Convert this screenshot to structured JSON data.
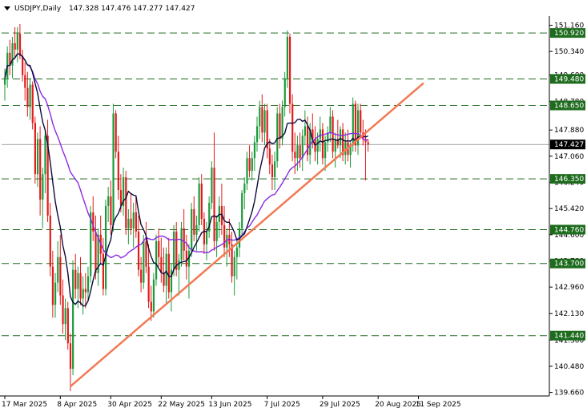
{
  "header": {
    "symbol": "USDJPY,Daily",
    "ohlc": "147.328 147.476 147.277 147.427"
  },
  "colors": {
    "background": "#ffffff",
    "axis": "#000000",
    "bull": "#1c9a3a",
    "bear": "#e31b1b",
    "ma_fast": "#0b0b3b",
    "ma_slow": "#8a2be2",
    "trendline": "#f27a55",
    "level_line": "#1e6b1e",
    "price_line": "#888888"
  },
  "chart_data": {
    "type": "candlestick",
    "title": "USDJPY,Daily",
    "y_ticks": [
      "151.160",
      "150.340",
      "149.600",
      "148.780",
      "147.880",
      "147.060",
      "146.240",
      "145.420",
      "144.600",
      "143.780",
      "142.960",
      "142.130",
      "141.300",
      "140.480",
      "139.660"
    ],
    "x_ticks": [
      "17 Mar 2025",
      "8 Apr 2025",
      "30 Apr 2025",
      "22 May 2025",
      "13 Jun 2025",
      "7 Jul 2025",
      "29 Jul 2025",
      "20 Aug 2025",
      "11 Sep 2025"
    ],
    "ylim": [
      139.55,
      151.45
    ],
    "levels": [
      {
        "value": 150.92,
        "label": "150.920"
      },
      {
        "value": 149.48,
        "label": "149.480"
      },
      {
        "value": 148.65,
        "label": "148.650"
      },
      {
        "value": 146.35,
        "label": "146.350"
      },
      {
        "value": 144.76,
        "label": "144.760"
      },
      {
        "value": 143.7,
        "label": "143.700"
      },
      {
        "value": 141.44,
        "label": "141.440"
      }
    ],
    "current_price": {
      "value": 147.427,
      "label": "147.427"
    },
    "trendline": {
      "from": {
        "bar": 26,
        "price": 139.85
      },
      "to": {
        "bar": 166,
        "price": 149.35
      }
    },
    "candles": [
      [
        149.3,
        149.8,
        148.8,
        149.5
      ],
      [
        149.5,
        150.5,
        149.2,
        150.3
      ],
      [
        150.3,
        150.7,
        149.6,
        149.9
      ],
      [
        149.9,
        150.8,
        149.5,
        150.6
      ],
      [
        150.6,
        151.1,
        150.1,
        150.4
      ],
      [
        150.4,
        151.1,
        150.0,
        150.9
      ],
      [
        150.9,
        151.2,
        150.1,
        150.2
      ],
      [
        150.2,
        150.4,
        149.4,
        149.6
      ],
      [
        149.6,
        150.0,
        148.8,
        149.2
      ],
      [
        149.2,
        149.7,
        148.3,
        148.6
      ],
      [
        148.6,
        149.5,
        148.2,
        149.3
      ],
      [
        149.3,
        149.4,
        147.9,
        148.1
      ],
      [
        148.1,
        148.3,
        146.2,
        146.5
      ],
      [
        146.5,
        147.8,
        146.1,
        147.6
      ],
      [
        147.6,
        148.0,
        145.2,
        145.7
      ],
      [
        145.7,
        146.7,
        144.8,
        146.5
      ],
      [
        146.5,
        147.9,
        145.9,
        147.7
      ],
      [
        147.7,
        148.2,
        145.0,
        145.2
      ],
      [
        145.2,
        145.6,
        143.3,
        143.6
      ],
      [
        143.6,
        144.1,
        142.0,
        142.4
      ],
      [
        142.4,
        143.4,
        142.0,
        143.1
      ],
      [
        143.1,
        144.4,
        142.8,
        143.9
      ],
      [
        143.9,
        144.6,
        142.4,
        142.7
      ],
      [
        142.7,
        143.2,
        141.5,
        141.8
      ],
      [
        141.8,
        142.6,
        141.3,
        142.3
      ],
      [
        142.3,
        142.5,
        141.0,
        141.2
      ],
      [
        141.2,
        141.5,
        139.7,
        140.4
      ],
      [
        140.4,
        143.8,
        140.2,
        143.5
      ],
      [
        143.5,
        144.0,
        142.6,
        142.9
      ],
      [
        142.9,
        143.6,
        142.3,
        143.4
      ],
      [
        143.4,
        143.9,
        142.4,
        142.6
      ],
      [
        142.6,
        143.3,
        142.1,
        142.9
      ],
      [
        142.9,
        143.4,
        142.3,
        142.8
      ],
      [
        142.8,
        143.6,
        142.5,
        143.3
      ],
      [
        143.3,
        145.5,
        143.1,
        145.3
      ],
      [
        145.3,
        145.8,
        144.4,
        144.7
      ],
      [
        144.7,
        145.2,
        143.2,
        143.4
      ],
      [
        143.4,
        144.8,
        143.0,
        144.6
      ],
      [
        144.6,
        145.2,
        143.7,
        144.0
      ],
      [
        144.0,
        144.5,
        142.7,
        142.9
      ],
      [
        142.9,
        145.7,
        142.7,
        145.5
      ],
      [
        145.5,
        146.1,
        145.0,
        145.8
      ],
      [
        145.8,
        146.3,
        144.6,
        144.9
      ],
      [
        144.9,
        148.7,
        144.7,
        148.4
      ],
      [
        148.4,
        148.5,
        147.0,
        147.2
      ],
      [
        147.2,
        147.7,
        145.7,
        146.0
      ],
      [
        146.0,
        146.5,
        145.3,
        145.5
      ],
      [
        145.5,
        146.7,
        145.2,
        146.4
      ],
      [
        146.4,
        146.6,
        144.6,
        144.8
      ],
      [
        144.8,
        145.4,
        144.3,
        145.1
      ],
      [
        145.1,
        145.9,
        144.6,
        144.8
      ],
      [
        144.8,
        145.6,
        144.2,
        145.3
      ],
      [
        145.3,
        145.8,
        144.5,
        144.7
      ],
      [
        144.7,
        145.2,
        143.3,
        143.5
      ],
      [
        143.5,
        143.9,
        142.8,
        143.1
      ],
      [
        143.1,
        144.6,
        142.9,
        144.4
      ],
      [
        144.4,
        145.0,
        143.4,
        143.6
      ],
      [
        143.6,
        144.3,
        142.3,
        142.5
      ],
      [
        142.5,
        143.0,
        141.9,
        142.2
      ],
      [
        142.2,
        143.4,
        142.0,
        143.2
      ],
      [
        143.2,
        144.6,
        143.0,
        144.4
      ],
      [
        144.4,
        144.8,
        143.6,
        143.9
      ],
      [
        143.9,
        144.5,
        143.1,
        143.4
      ],
      [
        143.4,
        144.2,
        142.8,
        143.0
      ],
      [
        143.0,
        144.2,
        142.4,
        144.0
      ],
      [
        144.0,
        144.5,
        142.6,
        142.8
      ],
      [
        142.8,
        143.7,
        142.2,
        143.5
      ],
      [
        143.5,
        144.9,
        143.3,
        144.7
      ],
      [
        144.7,
        145.0,
        143.3,
        143.5
      ],
      [
        143.5,
        144.0,
        142.7,
        143.8
      ],
      [
        143.8,
        145.0,
        143.6,
        144.8
      ],
      [
        144.8,
        145.4,
        143.8,
        144.1
      ],
      [
        144.1,
        144.6,
        143.2,
        143.6
      ],
      [
        143.6,
        144.3,
        142.6,
        144.1
      ],
      [
        144.1,
        145.6,
        143.9,
        145.4
      ],
      [
        145.4,
        145.8,
        144.4,
        144.6
      ],
      [
        144.6,
        145.2,
        144.1,
        144.9
      ],
      [
        144.9,
        146.4,
        144.7,
        146.2
      ],
      [
        146.2,
        146.5,
        144.9,
        145.1
      ],
      [
        145.1,
        145.3,
        144.0,
        144.3
      ],
      [
        144.3,
        145.0,
        143.8,
        144.7
      ],
      [
        144.7,
        145.8,
        144.5,
        145.6
      ],
      [
        145.6,
        146.9,
        145.4,
        146.7
      ],
      [
        146.7,
        147.8,
        144.1,
        144.4
      ],
      [
        144.4,
        145.2,
        143.9,
        145.0
      ],
      [
        145.0,
        145.8,
        144.5,
        145.5
      ],
      [
        145.5,
        146.2,
        144.6,
        144.9
      ],
      [
        144.9,
        145.5,
        143.9,
        144.2
      ],
      [
        144.2,
        144.8,
        143.6,
        144.6
      ],
      [
        144.6,
        145.1,
        143.9,
        144.3
      ],
      [
        144.3,
        144.7,
        143.1,
        143.3
      ],
      [
        143.3,
        144.1,
        142.7,
        143.9
      ],
      [
        143.9,
        144.4,
        143.2,
        144.2
      ],
      [
        144.2,
        145.0,
        143.9,
        144.8
      ],
      [
        144.8,
        146.0,
        144.6,
        145.9
      ],
      [
        145.9,
        146.4,
        145.4,
        146.2
      ],
      [
        146.2,
        147.2,
        146.0,
        147.0
      ],
      [
        147.0,
        147.4,
        146.4,
        146.6
      ],
      [
        146.6,
        147.2,
        146.3,
        147.0
      ],
      [
        147.0,
        147.7,
        146.6,
        147.5
      ],
      [
        147.5,
        148.3,
        147.2,
        148.0
      ],
      [
        148.0,
        148.8,
        147.6,
        148.6
      ],
      [
        148.6,
        149.0,
        147.5,
        147.8
      ],
      [
        147.8,
        148.7,
        147.4,
        148.5
      ],
      [
        148.5,
        148.7,
        147.0,
        147.3
      ],
      [
        147.3,
        147.6,
        146.5,
        146.8
      ],
      [
        146.8,
        147.1,
        146.0,
        146.4
      ],
      [
        146.4,
        147.2,
        146.0,
        146.9
      ],
      [
        146.9,
        148.6,
        146.7,
        148.4
      ],
      [
        148.4,
        148.7,
        147.3,
        147.6
      ],
      [
        147.6,
        148.8,
        147.4,
        148.6
      ],
      [
        148.6,
        149.7,
        148.3,
        149.5
      ],
      [
        149.5,
        151.0,
        149.2,
        150.8
      ],
      [
        150.8,
        150.9,
        148.4,
        148.7
      ],
      [
        148.7,
        149.0,
        146.9,
        147.2
      ],
      [
        147.2,
        147.8,
        146.5,
        147.0
      ],
      [
        147.0,
        147.7,
        146.6,
        147.4
      ],
      [
        147.4,
        147.8,
        146.7,
        147.0
      ],
      [
        147.0,
        147.9,
        146.6,
        147.7
      ],
      [
        147.7,
        148.5,
        147.4,
        148.0
      ],
      [
        148.0,
        148.3,
        146.9,
        147.1
      ],
      [
        147.1,
        148.1,
        146.8,
        147.9
      ],
      [
        147.9,
        148.4,
        147.3,
        147.6
      ],
      [
        147.6,
        148.0,
        146.9,
        147.2
      ],
      [
        147.2,
        147.8,
        146.8,
        147.6
      ],
      [
        147.6,
        148.3,
        147.2,
        147.9
      ],
      [
        147.9,
        148.1,
        146.8,
        147.0
      ],
      [
        147.0,
        147.7,
        146.6,
        147.5
      ],
      [
        147.5,
        148.0,
        147.2,
        147.8
      ],
      [
        147.8,
        148.6,
        147.5,
        148.3
      ],
      [
        148.3,
        148.5,
        147.0,
        147.2
      ],
      [
        147.2,
        147.8,
        146.7,
        147.6
      ],
      [
        147.6,
        148.2,
        147.3,
        147.4
      ],
      [
        147.4,
        148.0,
        147.0,
        147.9
      ],
      [
        147.9,
        148.1,
        146.9,
        147.1
      ],
      [
        147.1,
        147.8,
        146.8,
        147.5
      ],
      [
        147.5,
        147.9,
        146.9,
        147.1
      ],
      [
        147.1,
        147.5,
        146.7,
        147.4
      ],
      [
        147.4,
        148.9,
        147.2,
        148.7
      ],
      [
        148.7,
        148.8,
        147.2,
        147.4
      ],
      [
        147.4,
        148.7,
        147.1,
        148.5
      ],
      [
        148.5,
        148.7,
        147.6,
        147.8
      ],
      [
        147.8,
        148.2,
        147.4,
        147.6
      ],
      [
        147.6,
        147.9,
        146.3,
        147.5
      ],
      [
        147.5,
        147.6,
        147.2,
        147.43
      ]
    ]
  }
}
